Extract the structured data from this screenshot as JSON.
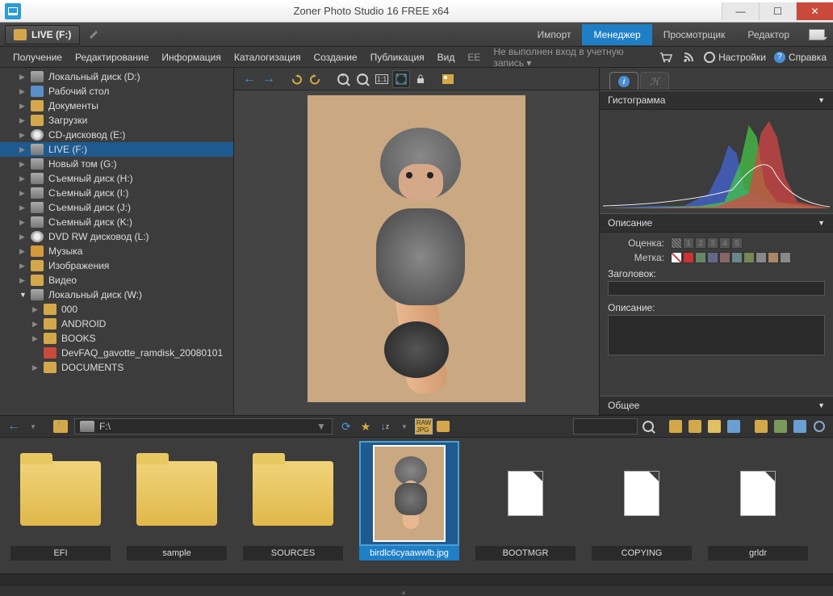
{
  "app": {
    "title": "Zoner Photo Studio 16 FREE x64"
  },
  "location_tab": "LIVE (F:)",
  "mode_tabs": {
    "import": "Импорт",
    "manager": "Менеджер",
    "viewer": "Просмотрщик",
    "editor": "Редактор"
  },
  "menubar": {
    "receive": "Получение",
    "edit": "Редактирование",
    "info": "Информация",
    "catalog": "Каталогизация",
    "create": "Создание",
    "publish": "Публикация",
    "view": "Вид",
    "ee": "EE",
    "login": "Не выполнен вход в учетную запись",
    "settings": "Настройки",
    "help": "Справка"
  },
  "tree": [
    {
      "label": "Локальный диск (D:)",
      "icon": "drive",
      "indent": 0
    },
    {
      "label": "Рабочий стол",
      "icon": "desktop",
      "indent": 0
    },
    {
      "label": "Документы",
      "icon": "folder",
      "indent": 0
    },
    {
      "label": "Загрузки",
      "icon": "folder",
      "indent": 0
    },
    {
      "label": "CD-дисковод (E:)",
      "icon": "cd",
      "indent": 0
    },
    {
      "label": "LIVE (F:)",
      "icon": "drive",
      "indent": 0,
      "selected": true
    },
    {
      "label": "Новый том (G:)",
      "icon": "drive",
      "indent": 0
    },
    {
      "label": "Съемный диск (H:)",
      "icon": "drive",
      "indent": 0
    },
    {
      "label": "Съемный диск (I:)",
      "icon": "drive",
      "indent": 0
    },
    {
      "label": "Съемный диск (J:)",
      "icon": "drive",
      "indent": 0
    },
    {
      "label": "Съемный диск (K:)",
      "icon": "drive",
      "indent": 0
    },
    {
      "label": "DVD RW дисковод (L:)",
      "icon": "cd",
      "indent": 0
    },
    {
      "label": "Музыка",
      "icon": "music",
      "indent": 0
    },
    {
      "label": "Изображения",
      "icon": "folder",
      "indent": 0
    },
    {
      "label": "Видео",
      "icon": "folder",
      "indent": 0
    },
    {
      "label": "Локальный диск (W:)",
      "icon": "drive",
      "indent": 0,
      "open": true
    },
    {
      "label": "000",
      "icon": "folder",
      "indent": 1
    },
    {
      "label": "ANDROID",
      "icon": "folder",
      "indent": 1
    },
    {
      "label": "BOOKS",
      "icon": "folder",
      "indent": 1
    },
    {
      "label": "DevFAQ_gavotte_ramdisk_20080101",
      "icon": "pdf",
      "indent": 1,
      "noarrow": true
    },
    {
      "label": "DOCUMENTS",
      "icon": "folder",
      "indent": 1
    }
  ],
  "info": {
    "histogram_title": "Гистограмма",
    "desc_title": "Описание",
    "rating_label": "Оценка:",
    "mark_label": "Метка:",
    "title_label": "Заголовок:",
    "description_label": "Описание:",
    "general_title": "Общее",
    "tag_colors": [
      "#cc3333",
      "#668866",
      "#666688",
      "#886666",
      "#668888",
      "#778855",
      "#888888",
      "#aa8866",
      "#888888"
    ]
  },
  "path": "F:\\",
  "thumbs": [
    {
      "label": "EFI",
      "type": "folder"
    },
    {
      "label": "sample",
      "type": "folder"
    },
    {
      "label": "SOURCES",
      "type": "folder"
    },
    {
      "label": "birdlc6cyaawwlb.jpg",
      "type": "image",
      "selected": true
    },
    {
      "label": "BOOTMGR",
      "type": "file"
    },
    {
      "label": "COPYING",
      "type": "file"
    },
    {
      "label": "grldr",
      "type": "file"
    }
  ]
}
